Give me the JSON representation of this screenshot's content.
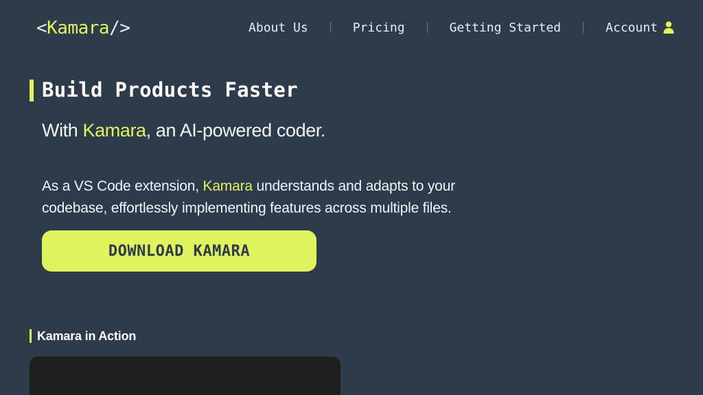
{
  "header": {
    "logo": {
      "open": "<",
      "name": "Kamara",
      "close": "/>"
    },
    "nav": {
      "about": "About Us",
      "pricing": "Pricing",
      "getting_started": "Getting Started",
      "account": "Account"
    },
    "account_icon": "user-icon"
  },
  "hero": {
    "title": "Build Products Faster",
    "subtitle_prefix": "With ",
    "subtitle_brand": "Kamara",
    "subtitle_suffix": ", an AI-powered coder.",
    "desc_prefix": "As a VS Code extension, ",
    "desc_brand": "Kamara",
    "desc_suffix": " understands and adapts to your codebase, effortlessly implementing features across multiple files.",
    "download_label": "DOWNLOAD KAMARA"
  },
  "section": {
    "title": "Kamara in Action"
  },
  "colors": {
    "background": "#2e3b4a",
    "accent": "#dff35f",
    "video_background": "#1e1e1e"
  }
}
